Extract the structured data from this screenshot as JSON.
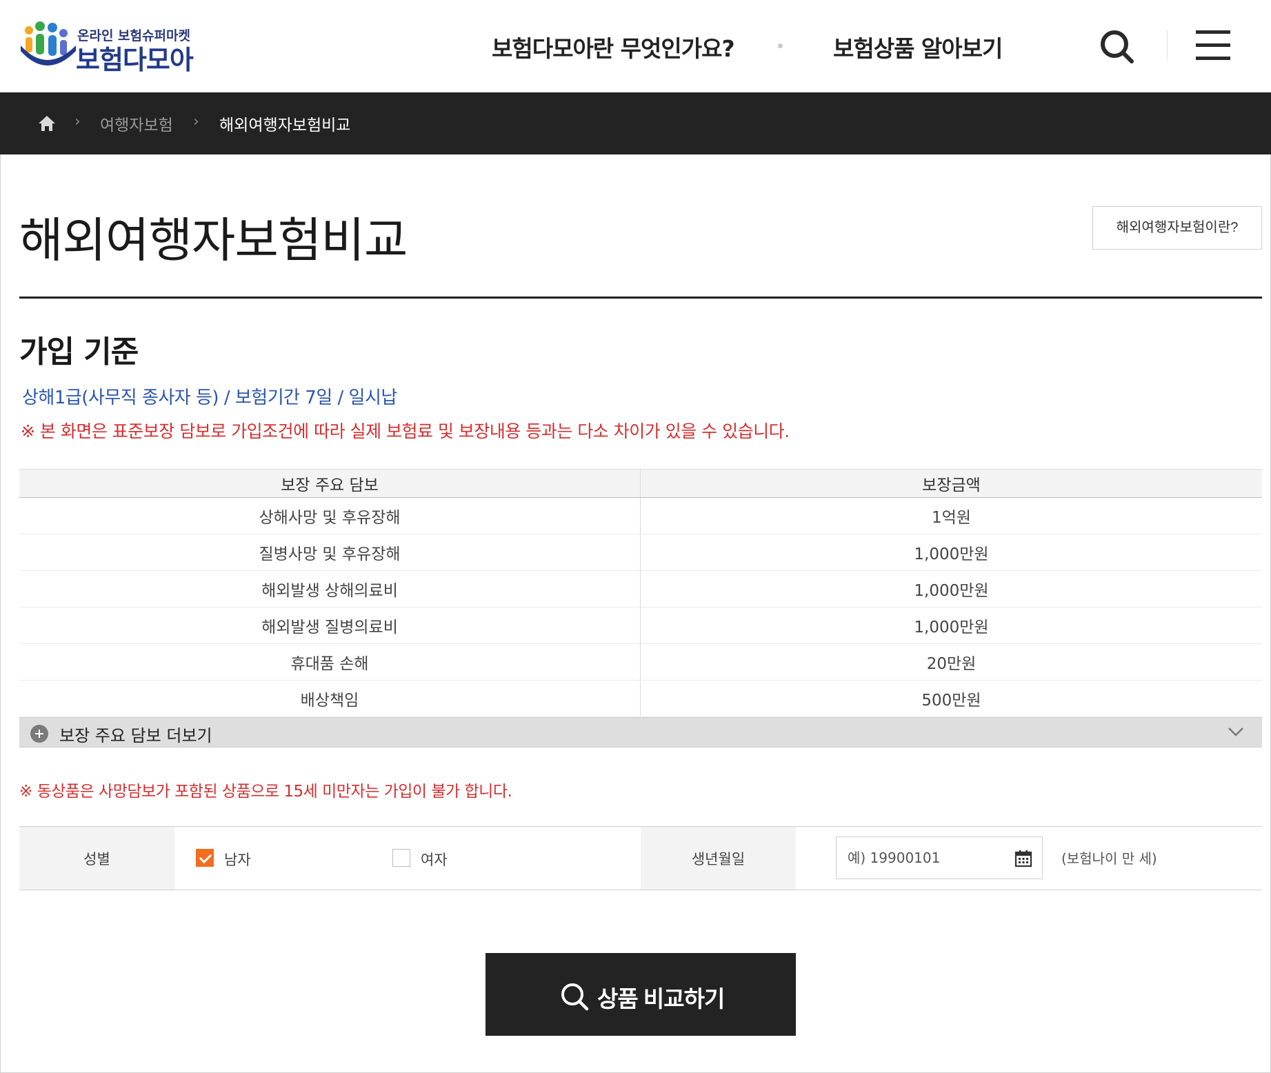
{
  "header": {
    "logo_sub": "온라인 보험슈퍼마켓",
    "logo_main": "보험다모아",
    "nav": [
      "보험다모아란 무엇인가요?",
      "보험상품 알아보기"
    ],
    "search_icon": "search-icon",
    "menu_icon": "hamburger-icon"
  },
  "breadcrumb": {
    "items": [
      "여행자보험",
      "해외여행자보험비교"
    ]
  },
  "page": {
    "title": "해외여행자보험비교",
    "about_button": "해외여행자보험이란?"
  },
  "section": {
    "title": "가입 기준",
    "basis": "상해1급(사무직 종사자 등) / 보험기간 7일 / 일시납",
    "notice": "※ 본 화면은 표준보장 담보로 가입조건에 따라 실제 보험료 및 보장내용 등과는 다소 차이가 있을 수 있습니다."
  },
  "coverage": {
    "headers": [
      "보장 주요 담보",
      "보장금액"
    ],
    "rows": [
      [
        "상해사망 및 후유장해",
        "1억원"
      ],
      [
        "질병사망 및 후유장해",
        "1,000만원"
      ],
      [
        "해외발생 상해의료비",
        "1,000만원"
      ],
      [
        "해외발생 질병의료비",
        "1,000만원"
      ],
      [
        "휴대품 손해",
        "20만원"
      ],
      [
        "배상책임",
        "500만원"
      ]
    ],
    "more_label": "보장 주요 담보 더보기"
  },
  "notice2": "※ 동상품은 사망담보가 포함된 상품으로 15세 미만자는 가입이 불가 합니다.",
  "form": {
    "gender_label": "성별",
    "male_label": "남자",
    "female_label": "여자",
    "male_checked": true,
    "female_checked": false,
    "birth_label": "생년월일",
    "birth_placeholder": "예) 19900101",
    "age_note": "(보험나이 만     세)"
  },
  "compare_button": "상품 비교하기",
  "colors": {
    "dark": "#232323",
    "accent_orange": "#f36d21",
    "notice_red": "#d52f2f",
    "basis_blue": "#2b55b0",
    "logo_navy": "#223a8c"
  }
}
